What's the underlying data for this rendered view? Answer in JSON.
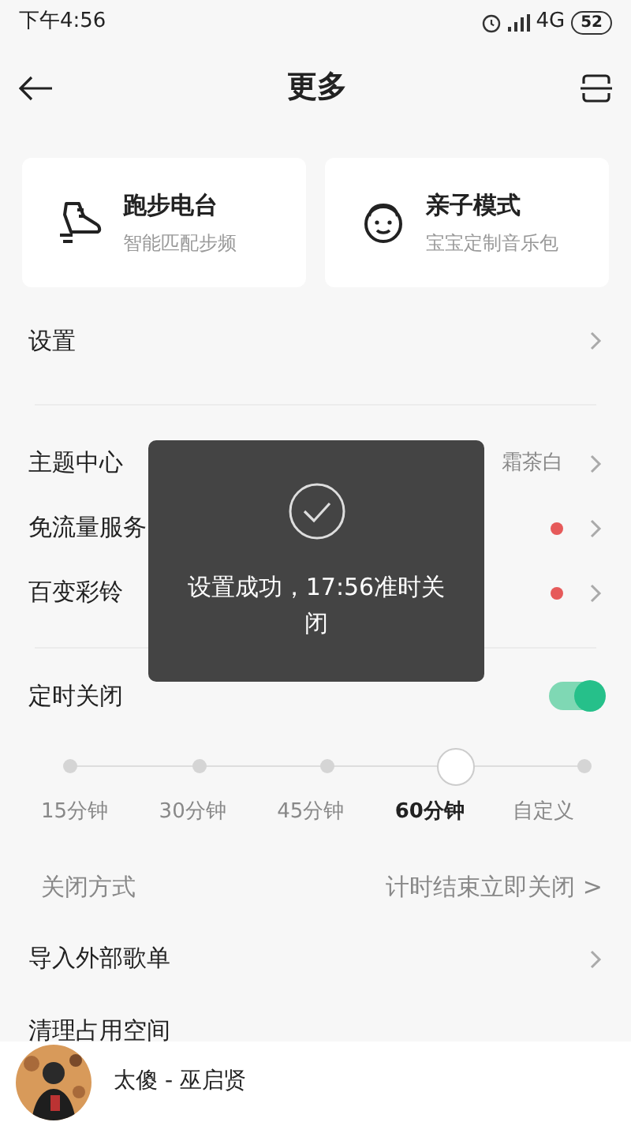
{
  "status_bar": {
    "time": "下午4:56",
    "network": "4G",
    "battery": "52"
  },
  "header": {
    "title": "更多"
  },
  "feature_cards": [
    {
      "kind": "running",
      "title": "跑步电台",
      "subtitle": "智能匹配步频"
    },
    {
      "kind": "kids",
      "title": "亲子模式",
      "subtitle": "宝宝定制音乐包"
    }
  ],
  "settings_row": {
    "label": "设置"
  },
  "menu_items": [
    {
      "label": "主题中心",
      "value": "霜茶白",
      "dot": false
    },
    {
      "label": "免流量服务",
      "dot": true
    },
    {
      "label": "百变彩铃",
      "dot": true
    }
  ],
  "timer": {
    "label": "定时关闭",
    "on": true,
    "options": [
      {
        "label": "15分钟",
        "selected": false
      },
      {
        "label": "30分钟",
        "selected": false
      },
      {
        "label": "45分钟",
        "selected": false
      },
      {
        "label": "60分钟",
        "selected": true
      },
      {
        "label": "自定义",
        "selected": false
      }
    ],
    "close_mode": {
      "label": "关闭方式",
      "value": "计时结束立即关闭 >"
    }
  },
  "more_items": [
    {
      "label": "导入外部歌单"
    },
    {
      "label": "清理占用空间"
    }
  ],
  "toast": {
    "message": "设置成功，17:56准时关闭"
  },
  "player": {
    "song": "太傻 - 巫启贤"
  }
}
